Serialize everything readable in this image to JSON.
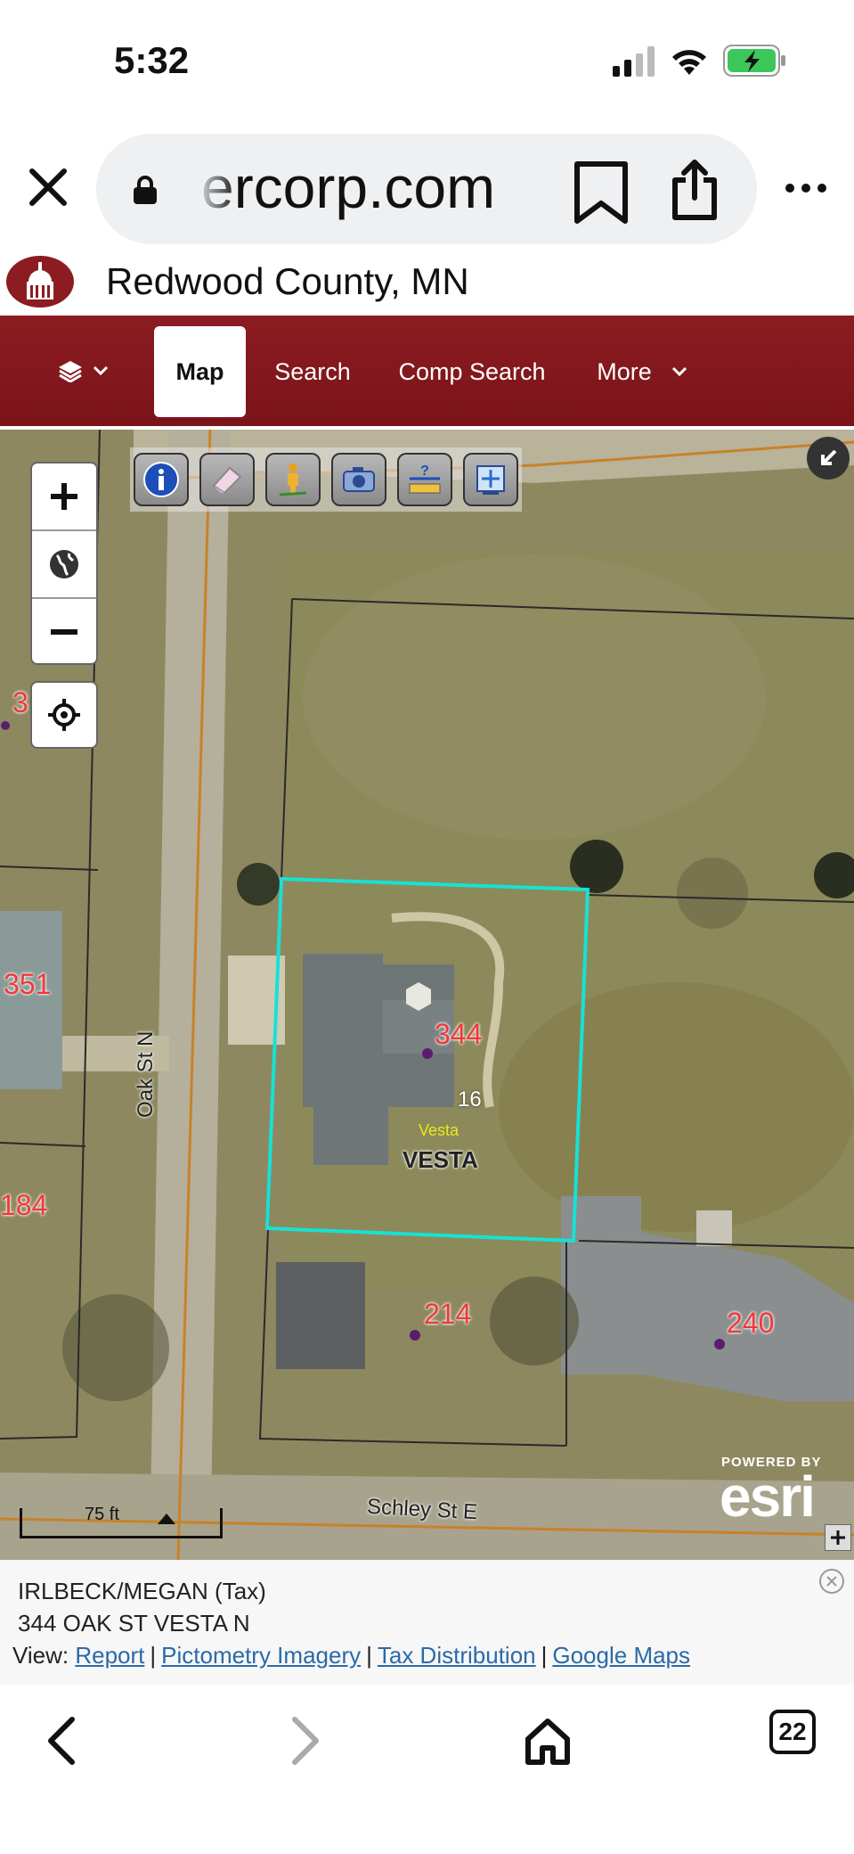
{
  "status_bar": {
    "time": "5:32"
  },
  "browser": {
    "url_text": "ercorp.com"
  },
  "site": {
    "title": "Redwood County, MN"
  },
  "nav": {
    "tabs": [
      {
        "label": "Map",
        "active": true
      },
      {
        "label": "Search",
        "active": false
      },
      {
        "label": "Comp Search",
        "active": false
      },
      {
        "label": "More",
        "active": false
      }
    ]
  },
  "map": {
    "parcel_labels": [
      "3",
      "351",
      "344",
      "184",
      "214",
      "240"
    ],
    "lot_number": "16",
    "subdivision_label": "Vesta",
    "city_label": "VESTA",
    "streets": [
      "Oak St N",
      "Schley St E"
    ],
    "scale_text": "75 ft",
    "esri": {
      "powered_by": "POWERED BY",
      "wordmark": "esri"
    },
    "colors": {
      "selected_parcel": "#19e0d6",
      "parcel_label": "#f03838",
      "road_line": "#c8822a"
    },
    "tools": [
      "info-icon",
      "eraser-icon",
      "person-icon",
      "camera-icon",
      "measure-icon",
      "print-icon"
    ]
  },
  "info_panel": {
    "owner": "IRLBECK/MEGAN (Tax)",
    "address": "344 OAK ST VESTA N",
    "view_label": "View:",
    "links": [
      "Report",
      "Pictometry Imagery",
      "Tax Distribution",
      "Google Maps"
    ]
  },
  "bottom_bar": {
    "tabs_count": "22"
  }
}
